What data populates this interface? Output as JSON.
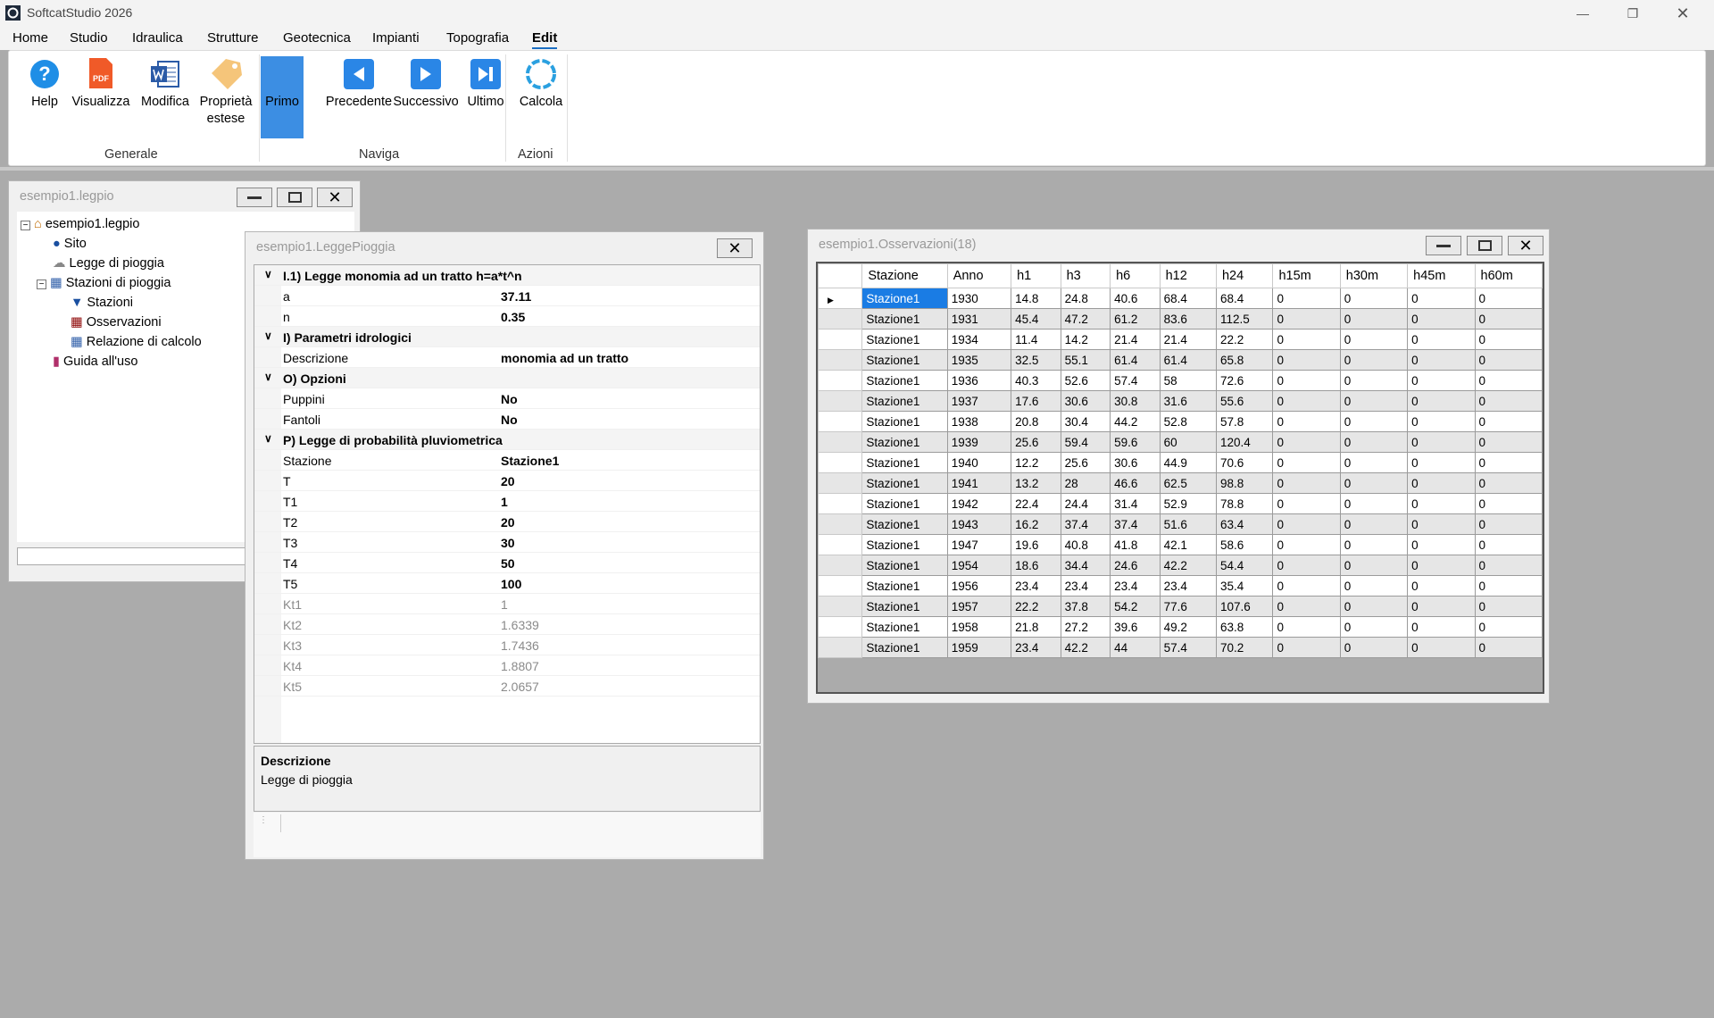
{
  "app": {
    "title": "SoftcatStudio 2026"
  },
  "menu": [
    "Home",
    "Studio",
    "Idraulica",
    "Strutture",
    "Geotecnica",
    "Impianti",
    "Topografia",
    "Edit"
  ],
  "ribbon": {
    "buttons": [
      "Help",
      "Visualizza",
      "Modifica",
      "Proprietà",
      "estese",
      "Primo",
      "Precedente",
      "Successivo",
      "Ultimo",
      "Calcola"
    ],
    "groups": [
      "Generale",
      "Naviga",
      "Azioni"
    ],
    "pdf_text": "PDF"
  },
  "project_window": {
    "title": "esempio1.legpio",
    "tree": [
      "esempio1.legpio",
      "Sito",
      "Legge di pioggia",
      "Stazioni di pioggia",
      "Stazioni",
      "Osservazioni",
      "Relazione di calcolo",
      "Guida all'uso"
    ]
  },
  "legge_window": {
    "title": "esempio1.LeggePioggia",
    "rows": [
      {
        "label": "I.1) Legge monomia ad un tratto h=a*t^n",
        "value": ""
      },
      {
        "label": "a",
        "value": "37.11"
      },
      {
        "label": "n",
        "value": "0.35"
      },
      {
        "label": "I) Parametri idrologici",
        "value": ""
      },
      {
        "label": "Descrizione",
        "value": "monomia ad un tratto"
      },
      {
        "label": "O) Opzioni",
        "value": ""
      },
      {
        "label": "Puppini",
        "value": "No"
      },
      {
        "label": "Fantoli",
        "value": "No"
      },
      {
        "label": "P) Legge di probabilità pluviometrica",
        "value": ""
      },
      {
        "label": "Stazione",
        "value": "Stazione1"
      },
      {
        "label": "T",
        "value": "20"
      },
      {
        "label": "T1",
        "value": "1"
      },
      {
        "label": "T2",
        "value": "20"
      },
      {
        "label": "T3",
        "value": "30"
      },
      {
        "label": "T4",
        "value": "50"
      },
      {
        "label": "T5",
        "value": "100"
      },
      {
        "label": "Kt1",
        "value": "1"
      },
      {
        "label": "Kt2",
        "value": "1.6339"
      },
      {
        "label": "Kt3",
        "value": "1.7436"
      },
      {
        "label": "Kt4",
        "value": "1.8807"
      },
      {
        "label": "Kt5",
        "value": "2.0657"
      }
    ],
    "description_title": "Descrizione",
    "description_text": "Legge di pioggia"
  },
  "obs_window": {
    "title": "esempio1.Osservazioni(18)",
    "columns": [
      "Stazione",
      "Anno",
      "h1",
      "h3",
      "h6",
      "h12",
      "h24",
      "h15m",
      "h30m",
      "h45m",
      "h60m"
    ],
    "rows": [
      [
        "Stazione1",
        "1930",
        "14.8",
        "24.8",
        "40.6",
        "68.4",
        "68.4",
        "0",
        "0",
        "0",
        "0"
      ],
      [
        "Stazione1",
        "1931",
        "45.4",
        "47.2",
        "61.2",
        "83.6",
        "112.5",
        "0",
        "0",
        "0",
        "0"
      ],
      [
        "Stazione1",
        "1934",
        "11.4",
        "14.2",
        "21.4",
        "21.4",
        "22.2",
        "0",
        "0",
        "0",
        "0"
      ],
      [
        "Stazione1",
        "1935",
        "32.5",
        "55.1",
        "61.4",
        "61.4",
        "65.8",
        "0",
        "0",
        "0",
        "0"
      ],
      [
        "Stazione1",
        "1936",
        "40.3",
        "52.6",
        "57.4",
        "58",
        "72.6",
        "0",
        "0",
        "0",
        "0"
      ],
      [
        "Stazione1",
        "1937",
        "17.6",
        "30.6",
        "30.8",
        "31.6",
        "55.6",
        "0",
        "0",
        "0",
        "0"
      ],
      [
        "Stazione1",
        "1938",
        "20.8",
        "30.4",
        "44.2",
        "52.8",
        "57.8",
        "0",
        "0",
        "0",
        "0"
      ],
      [
        "Stazione1",
        "1939",
        "25.6",
        "59.4",
        "59.6",
        "60",
        "120.4",
        "0",
        "0",
        "0",
        "0"
      ],
      [
        "Stazione1",
        "1940",
        "12.2",
        "25.6",
        "30.6",
        "44.9",
        "70.6",
        "0",
        "0",
        "0",
        "0"
      ],
      [
        "Stazione1",
        "1941",
        "13.2",
        "28",
        "46.6",
        "62.5",
        "98.8",
        "0",
        "0",
        "0",
        "0"
      ],
      [
        "Stazione1",
        "1942",
        "22.4",
        "24.4",
        "31.4",
        "52.9",
        "78.8",
        "0",
        "0",
        "0",
        "0"
      ],
      [
        "Stazione1",
        "1943",
        "16.2",
        "37.4",
        "37.4",
        "51.6",
        "63.4",
        "0",
        "0",
        "0",
        "0"
      ],
      [
        "Stazione1",
        "1947",
        "19.6",
        "40.8",
        "41.8",
        "42.1",
        "58.6",
        "0",
        "0",
        "0",
        "0"
      ],
      [
        "Stazione1",
        "1954",
        "18.6",
        "34.4",
        "24.6",
        "42.2",
        "54.4",
        "0",
        "0",
        "0",
        "0"
      ],
      [
        "Stazione1",
        "1956",
        "23.4",
        "23.4",
        "23.4",
        "23.4",
        "35.4",
        "0",
        "0",
        "0",
        "0"
      ],
      [
        "Stazione1",
        "1957",
        "22.2",
        "37.8",
        "54.2",
        "77.6",
        "107.6",
        "0",
        "0",
        "0",
        "0"
      ],
      [
        "Stazione1",
        "1958",
        "21.8",
        "27.2",
        "39.6",
        "49.2",
        "63.8",
        "0",
        "0",
        "0",
        "0"
      ],
      [
        "Stazione1",
        "1959",
        "23.4",
        "42.2",
        "44",
        "57.4",
        "70.2",
        "0",
        "0",
        "0",
        "0"
      ]
    ]
  },
  "colors": {
    "accent": "#1a7ce4",
    "pressed": "#3c8ee3"
  }
}
